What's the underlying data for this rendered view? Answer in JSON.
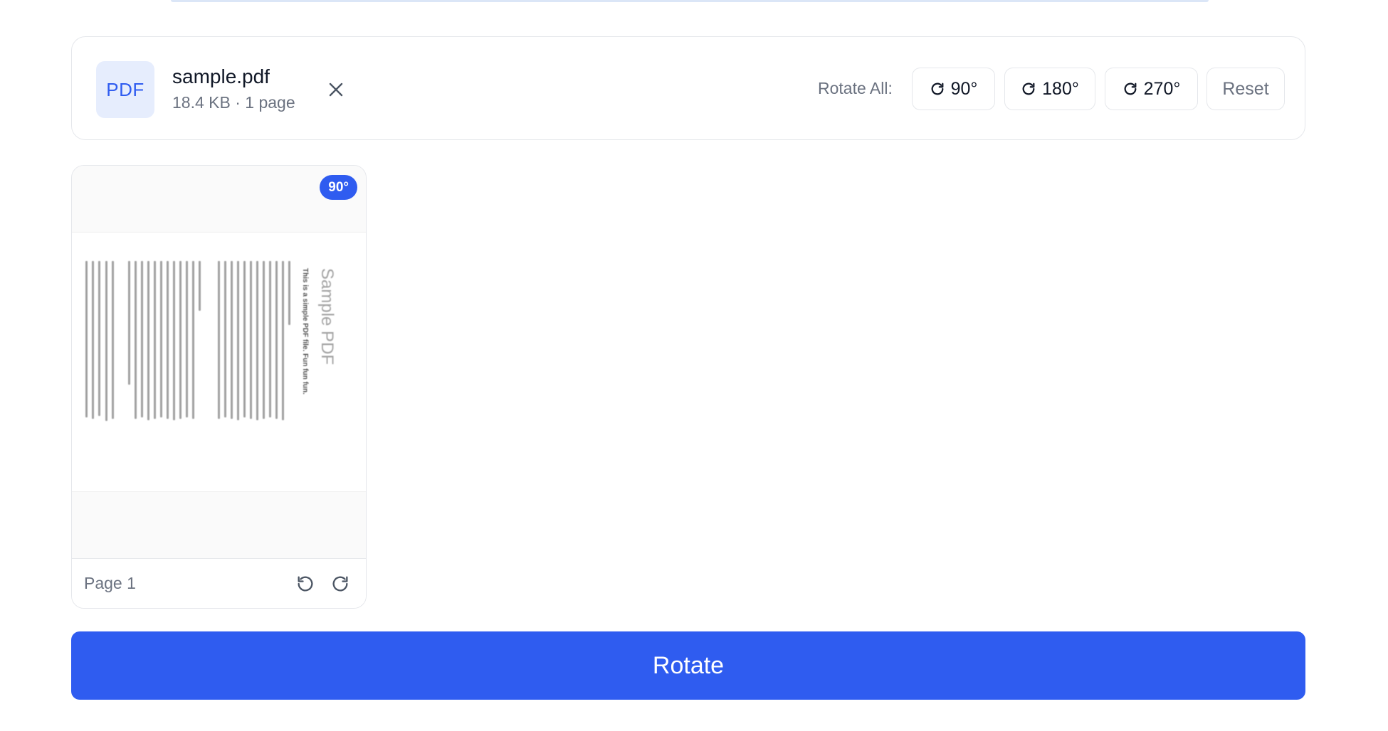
{
  "file": {
    "badge": "PDF",
    "name": "sample.pdf",
    "meta": "18.4 KB · 1 page"
  },
  "toolbar": {
    "rotate_all_label": "Rotate All:",
    "buttons": [
      {
        "label": "90°",
        "icon": "rotate-cw-icon"
      },
      {
        "label": "180°",
        "icon": "rotate-cw-icon"
      },
      {
        "label": "270°",
        "icon": "rotate-cw-icon"
      }
    ],
    "reset_label": "Reset"
  },
  "pages": [
    {
      "label": "Page 1",
      "angle_badge": "90°",
      "preview": {
        "title": "Sample PDF",
        "subtitle": "This is a simple PDF file. Fun fun fun."
      }
    }
  ],
  "primary_action": "Rotate",
  "colors": {
    "accent": "#2f5cf0",
    "badge_bg": "#e6edfd",
    "border": "#e5e7eb",
    "muted_text": "#6b7280"
  }
}
